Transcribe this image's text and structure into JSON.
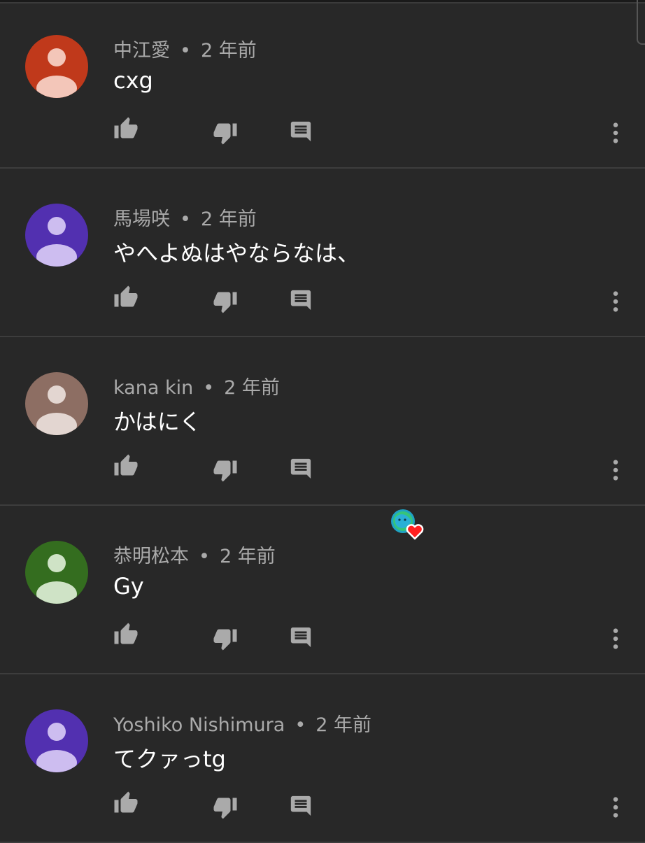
{
  "comments": [
    {
      "author": "中江愛",
      "time": "2 年前",
      "text": "cxg",
      "avatar_color": "#c0391b",
      "avatar_fg": "#f3c6b9"
    },
    {
      "author": "馬場咲",
      "time": "2 年前",
      "text": "やへよぬはやならなは、",
      "avatar_color": "#5230b0",
      "avatar_fg": "#cdbdf0"
    },
    {
      "author": "kana kin",
      "time": "2 年前",
      "text": "かはにく",
      "avatar_color": "#8d6e63",
      "avatar_fg": "#e3d6d1"
    },
    {
      "author": "恭明松本",
      "time": "2 年前",
      "text": "Gy",
      "avatar_color": "#346d1f",
      "avatar_fg": "#cfe3c6",
      "creator_hearted": true
    },
    {
      "author": "Yoshiko Nishimura",
      "time": "2 年前",
      "text": "てクァっtg",
      "avatar_color": "#5230b0",
      "avatar_fg": "#cdbdf0"
    }
  ],
  "separator": "•",
  "icons": {
    "like": "thumb-up-icon",
    "dislike": "thumb-down-icon",
    "reply": "reply-comment-icon",
    "more": "more-vert-icon",
    "heart": "creator-heart-icon"
  },
  "colors": {
    "background": "#282828",
    "icon": "#aaaaaa",
    "meta_text": "#aaaaaa",
    "heart": "#ff0000"
  }
}
